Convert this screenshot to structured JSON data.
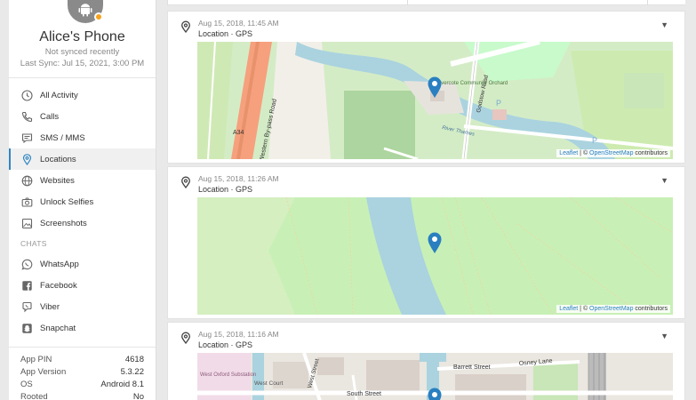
{
  "device": {
    "name": "Alice's Phone",
    "sync_status": "Not synced recently",
    "last_sync": "Last Sync: Jul 15, 2021, 3:00 PM"
  },
  "nav": {
    "all_activity": "All Activity",
    "calls": "Calls",
    "sms": "SMS / MMS",
    "locations": "Locations",
    "websites": "Websites",
    "unlock_selfies": "Unlock Selfies",
    "screenshots": "Screenshots",
    "chats_label": "CHATS",
    "whatsapp": "WhatsApp",
    "facebook": "Facebook",
    "viber": "Viber",
    "snapchat": "Snapchat"
  },
  "info": [
    {
      "label": "App PIN",
      "value": "4618"
    },
    {
      "label": "App Version",
      "value": "5.3.22"
    },
    {
      "label": "OS",
      "value": "Android 8.1"
    },
    {
      "label": "Rooted",
      "value": "No"
    }
  ],
  "locations": [
    {
      "time": "Aug 15, 2018, 11:45 AM",
      "source": "Location · GPS"
    },
    {
      "time": "Aug 15, 2018, 11:26 AM",
      "source": "Location · GPS"
    },
    {
      "time": "Aug 15, 2018, 11:16 AM",
      "source": "Location · GPS"
    }
  ],
  "map": {
    "attribution_leaflet": "Leaflet",
    "attribution_sep": " | © ",
    "attribution_osm": "OpenStreetMap",
    "attribution_tail": " contributors",
    "map1_labels": {
      "road_a34": "A34",
      "bypass": "Western By-pass Road",
      "orchard": "Wolvercote Community Orchard",
      "godstow": "Godstow Road",
      "river": "River Thames",
      "parking": "P"
    },
    "map3_labels": {
      "west_oxford": "West Oxford Substation",
      "west_court": "West Court",
      "west_street": "West Street",
      "barrett": "Barrett Street",
      "osney": "Osney Lane",
      "south": "South Street"
    }
  },
  "colors": {
    "accent": "#2e86c1",
    "marker": "#2a7fc0",
    "water": "#aad3df",
    "park": "#c8facc",
    "grass": "#cdebb0",
    "road_major": "#f6a07e",
    "building": "#d9d0c9"
  }
}
